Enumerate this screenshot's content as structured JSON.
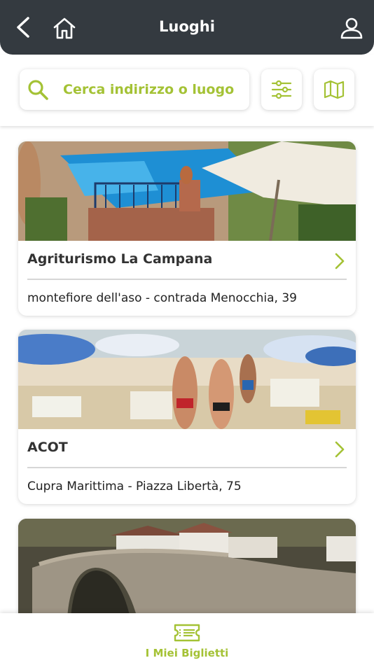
{
  "header": {
    "title": "Luoghi",
    "icons": {
      "back": "back-arrow-icon",
      "home": "home-icon",
      "user": "user-icon"
    }
  },
  "search": {
    "placeholder": "Cerca indirizzo o luogo",
    "icon": "search-icon",
    "filter_icon": "filter-sliders-icon",
    "map_icon": "map-icon"
  },
  "places": [
    {
      "name": "Agriturismo La Campana",
      "address": "montefiore dell'aso - contrada Menocchia, 39",
      "image": "pool with umbrella"
    },
    {
      "name": "ACOT",
      "address": "Cupra Marittima - Piazza Libertà, 75",
      "image": "beach with umbrellas"
    },
    {
      "name": "",
      "address": "",
      "image": "stone bridge with houses"
    }
  ],
  "bottom_nav": {
    "label": "I Miei Biglietti",
    "icon": "ticket-icon"
  },
  "colors": {
    "header_bg": "#343a40",
    "accent": "#a4c235",
    "text": "#333333"
  }
}
